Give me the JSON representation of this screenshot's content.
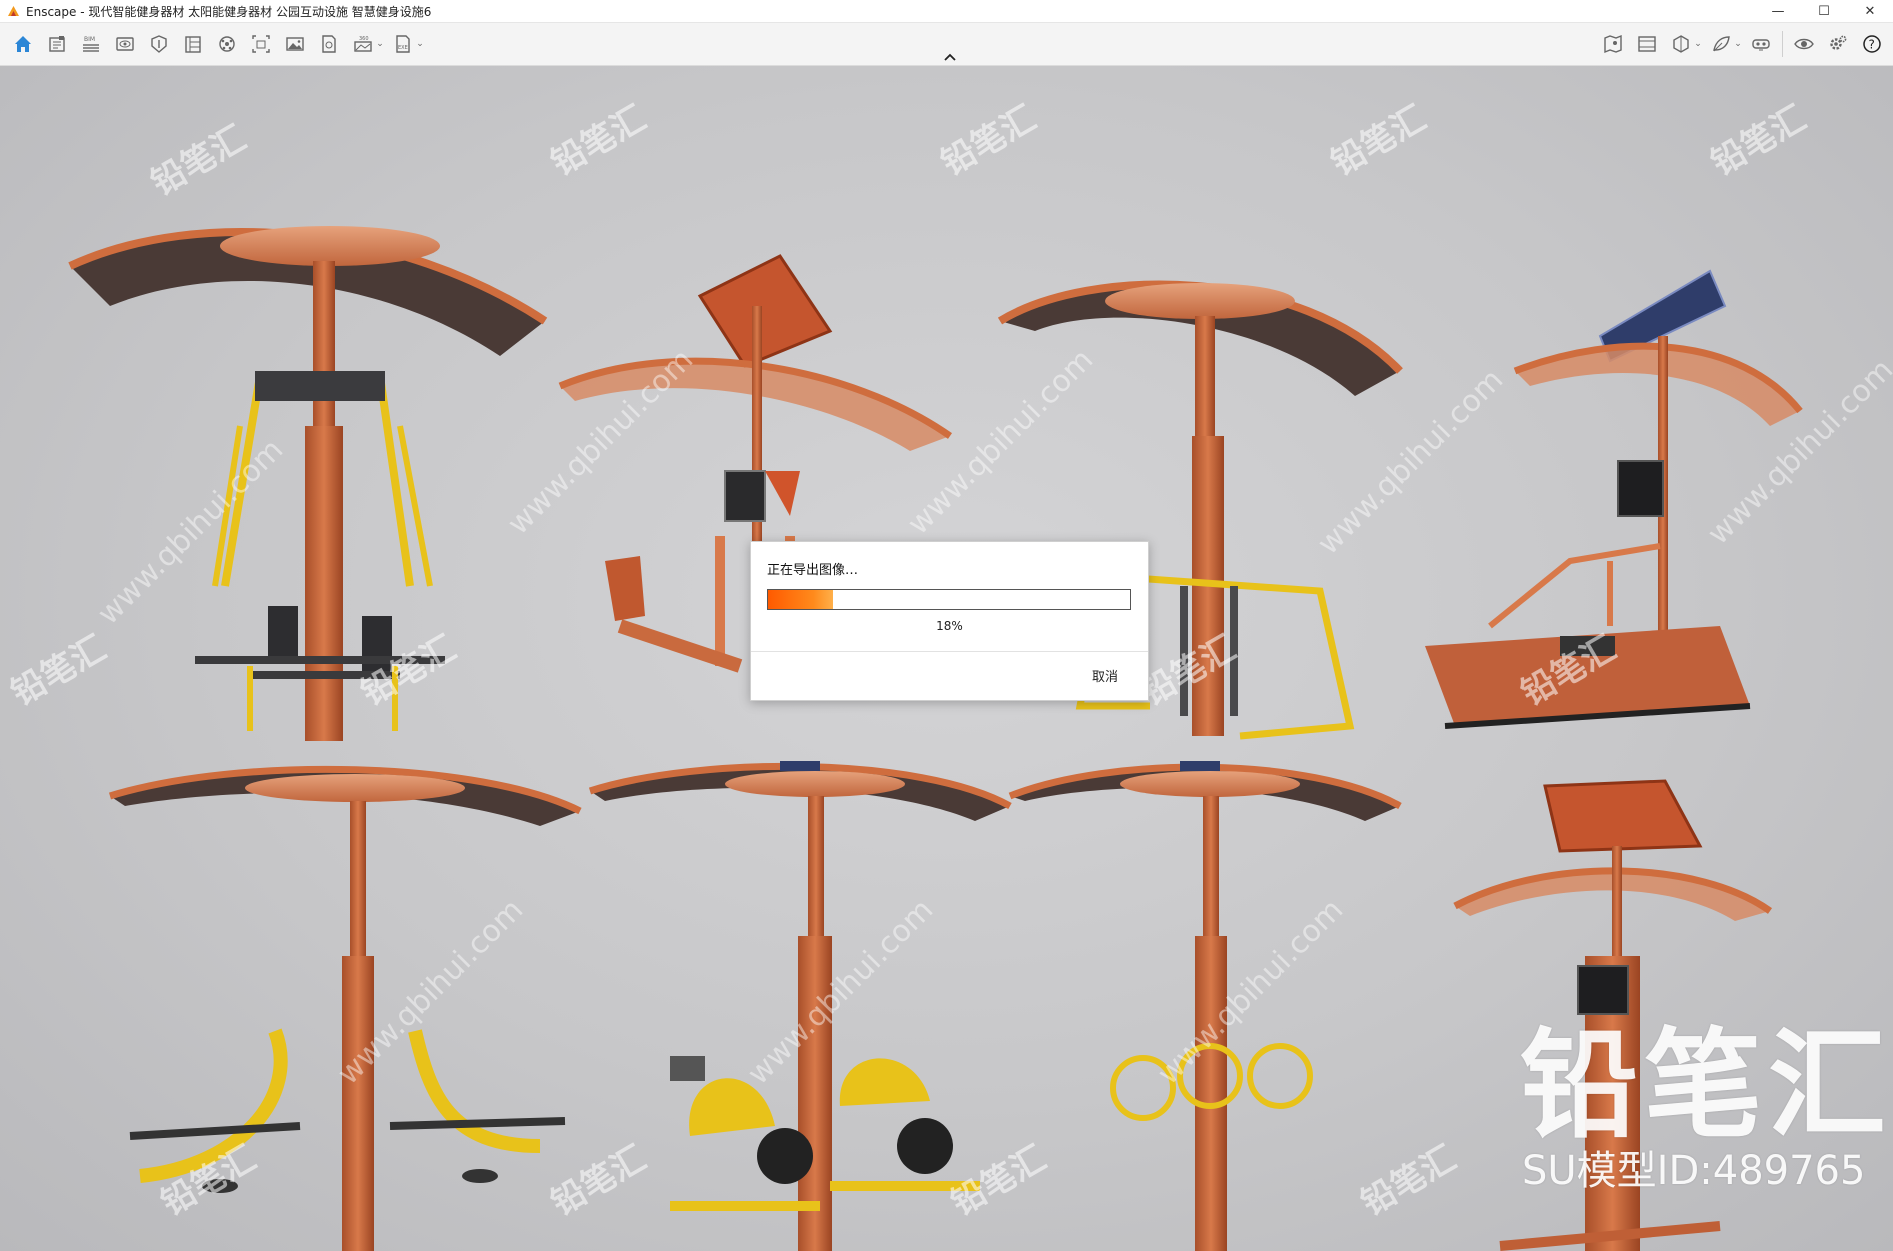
{
  "window": {
    "title": "Enscape - 现代智能健身器材 太阳能健身器材 公园互动设施 智慧健身设施6",
    "controls": {
      "minimize": "—",
      "maximize": "☐",
      "close": "✕"
    }
  },
  "toolbar": {
    "left_icons": [
      "home-icon",
      "project-icon",
      "bim-icon",
      "views-icon",
      "asset-library-icon",
      "material-editor-icon",
      "site-context-icon",
      "atmosphere-icon",
      "capture-icon",
      "screenshot-icon",
      "batch-render-icon",
      "panorama-icon",
      "exe-export-icon"
    ],
    "right_icons": [
      "visual-settings-icon",
      "settings-icon",
      "help-icon"
    ],
    "bim_label": "BIM",
    "pano_label": "360",
    "exe_label": "EXE"
  },
  "colors": {
    "accent": "#2b86d6",
    "progress": "#ff6a00",
    "frame": "#c9683e",
    "equipment_yellow": "#e8c21a"
  },
  "dialog": {
    "title": "正在导出图像…",
    "progress_percent": 18,
    "progress_label": "18%",
    "cancel_label": "取消"
  },
  "watermark": {
    "logo": "铅笔汇",
    "id_text": "SU模型ID:489765",
    "tile_text": "铅笔汇",
    "diag_text": "www.qbihui.com"
  }
}
